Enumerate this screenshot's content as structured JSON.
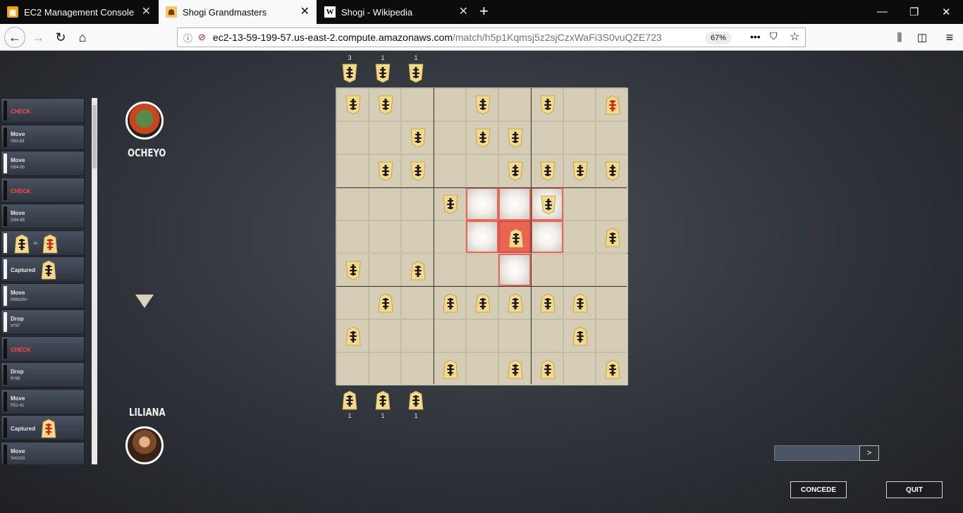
{
  "browser": {
    "tabs": [
      {
        "title": "EC2 Management Console",
        "icon": "cube-icon",
        "active": false
      },
      {
        "title": "Shogi Grandmasters",
        "icon": "shogi-icon",
        "active": true
      },
      {
        "title": "Shogi - Wikipedia",
        "icon": "wikipedia-icon",
        "active": false
      }
    ],
    "url_host": "ec2-13-59-199-57.us-east-2.compute.amazonaws.com",
    "url_path": "/match/h5p1Kqmsj5z2sjCzxWaFi3S0vuQZE723",
    "zoom": "67%"
  },
  "history": [
    {
      "type": "check",
      "title": "CHECK",
      "sub": "",
      "side": "black"
    },
    {
      "type": "move",
      "title": "Move",
      "sub": "S93-83",
      "side": "black"
    },
    {
      "type": "move",
      "title": "Move",
      "sub": "G64-65",
      "side": "white"
    },
    {
      "type": "check",
      "title": "CHECK",
      "sub": "",
      "side": "black"
    },
    {
      "type": "move",
      "title": "Move",
      "sub": "G94-85",
      "side": "black"
    },
    {
      "type": "promote",
      "title": "to",
      "sub": "",
      "side": "white"
    },
    {
      "type": "captured",
      "title": "Captured",
      "sub": "",
      "side": "white"
    },
    {
      "type": "move",
      "title": "Move",
      "sub": "R89x99+",
      "side": "white"
    },
    {
      "type": "drop",
      "title": "Drop",
      "sub": "N*97",
      "side": "white"
    },
    {
      "type": "check",
      "title": "CHECK",
      "sub": "",
      "side": "black"
    },
    {
      "type": "drop",
      "title": "Drop",
      "sub": "R*89",
      "side": "black"
    },
    {
      "type": "move",
      "title": "Move",
      "sub": "P51-41",
      "side": "black"
    },
    {
      "type": "captured",
      "title": "Captured",
      "sub": "",
      "side": "black"
    },
    {
      "type": "move",
      "title": "Move",
      "sub": "S42x53",
      "side": "black"
    }
  ],
  "players": {
    "top": {
      "name": "OCHEYO"
    },
    "bottom": {
      "name": "LILIANA"
    }
  },
  "board": {
    "rows": [
      [
        "w",
        "w",
        "",
        "",
        "w",
        "",
        "w",
        "",
        "rp"
      ],
      [
        "",
        "",
        "w",
        "",
        "w",
        "w",
        "",
        "",
        ""
      ],
      [
        "",
        "w",
        "w",
        "",
        "",
        "w",
        "w",
        "w",
        "w"
      ],
      [
        "",
        "",
        "",
        "w",
        "",
        "",
        "w",
        "",
        ""
      ],
      [
        "",
        "",
        "",
        "",
        "",
        "b",
        "",
        "",
        "b"
      ],
      [
        "w",
        "",
        "b",
        "",
        "",
        "",
        "",
        "",
        ""
      ],
      [
        "",
        "b",
        "",
        "b",
        "b",
        "b",
        "b",
        "b",
        ""
      ],
      [
        "b",
        "",
        "",
        "",
        "",
        "",
        "",
        "b",
        ""
      ],
      [
        "",
        "",
        "",
        "b",
        "",
        "b",
        "b",
        "",
        "b"
      ]
    ],
    "highlights": [
      [
        3,
        4
      ],
      [
        3,
        5
      ],
      [
        3,
        6
      ],
      [
        4,
        4
      ],
      [
        4,
        6
      ],
      [
        5,
        5
      ]
    ],
    "selected": [
      4,
      5
    ]
  },
  "hands": {
    "top": [
      {
        "count": "3"
      },
      {
        "count": "1"
      },
      {
        "count": "1"
      }
    ],
    "bottom": [
      {
        "count": "1"
      },
      {
        "count": "1"
      },
      {
        "count": "1"
      }
    ]
  },
  "controls": {
    "send_label": ">",
    "concede_label": "CONCEDE",
    "quit_label": "QUIT"
  }
}
